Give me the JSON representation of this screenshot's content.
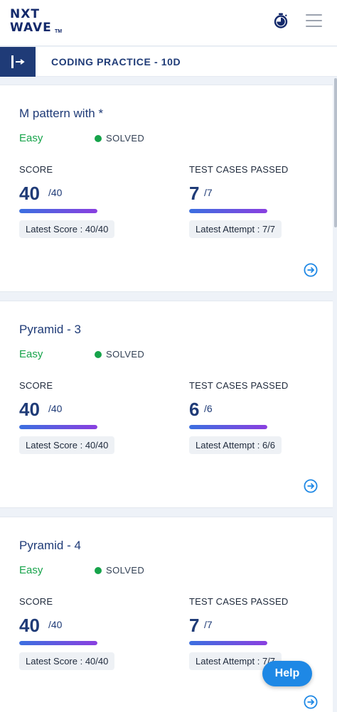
{
  "header": {
    "logo_line1": "NXT",
    "logo_line2": "WAVE",
    "logo_tm": "TM",
    "timer_icon": "stopwatch-icon",
    "menu_icon": "hamburger-menu-icon"
  },
  "subheader": {
    "toggle_icon": "sidebar-expand-icon",
    "title": "CODING PRACTICE - 10D"
  },
  "labels": {
    "score": "SCORE",
    "test_cases": "TEST CASES PASSED"
  },
  "problems": [
    {
      "title": "M pattern with *",
      "difficulty": "Easy",
      "status": "SOLVED",
      "score": "40",
      "score_total": "/40",
      "score_fraction": 1.0,
      "tests": "7",
      "tests_total": "/7",
      "tests_fraction": 1.0,
      "latest_score": "Latest Score : 40/40",
      "latest_attempt": "Latest Attempt : 7/7"
    },
    {
      "title": "Pyramid - 3",
      "difficulty": "Easy",
      "status": "SOLVED",
      "score": "40",
      "score_total": "/40",
      "score_fraction": 1.0,
      "tests": "6",
      "tests_total": "/6",
      "tests_fraction": 1.0,
      "latest_score": "Latest Score : 40/40",
      "latest_attempt": "Latest Attempt : 6/6"
    },
    {
      "title": "Pyramid - 4",
      "difficulty": "Easy",
      "status": "SOLVED",
      "score": "40",
      "score_total": "/40",
      "score_fraction": 1.0,
      "tests": "7",
      "tests_total": "/7",
      "tests_fraction": 1.0,
      "latest_score": "Latest Score : 40/40",
      "latest_attempt": "Latest Attempt : 7/7"
    }
  ],
  "help": {
    "label": "Help"
  },
  "colors": {
    "brand": "#1f3b77",
    "easy": "#16a34a",
    "help": "#1e88e5"
  }
}
